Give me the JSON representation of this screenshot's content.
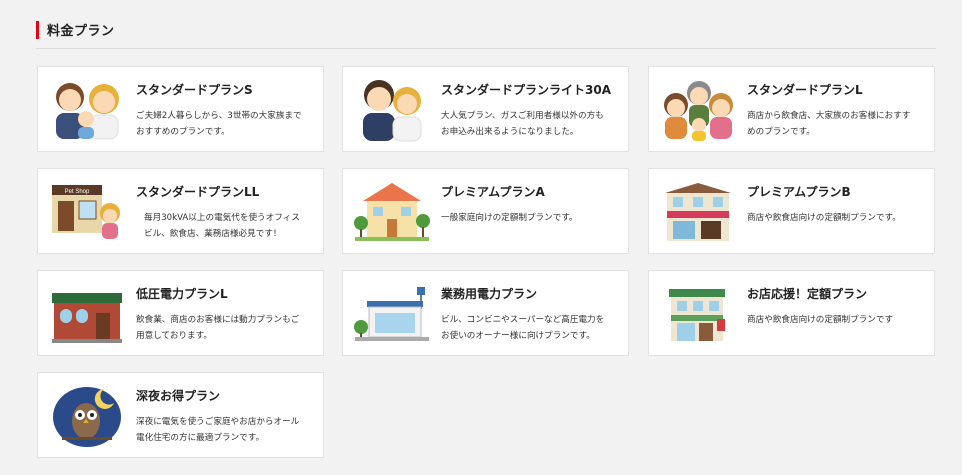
{
  "section": {
    "title": "料金プラン"
  },
  "plans": [
    {
      "name": "スタンダードプランS",
      "desc": [
        "ご夫婦2人暮らしから、3世帯の大家族まで",
        "おすすめのプランです。"
      ]
    },
    {
      "name": "スタンダードプランライト30A",
      "desc": [
        "大人気プラン、ガスご利用者様以外の方も",
        "お申込み出来るようになりました。"
      ]
    },
    {
      "name": "スタンダードプランL",
      "desc": [
        "商店から飲食店、大家族のお客様におすす",
        "めのプランです。"
      ]
    },
    {
      "name": "スタンダードプランLL",
      "desc": [
        "毎月30kVA以上の電気代を使うオフィス",
        "ビル、飲食店、業務店様必見です！"
      ]
    },
    {
      "name": "プレミアムプランA",
      "desc": [
        "一般家庭向けの定額制プランです。"
      ]
    },
    {
      "name": "プレミアムプランB",
      "desc": [
        "商店や飲食店向けの定額制プランです。"
      ]
    },
    {
      "name": "低圧電力プランL",
      "desc": [
        "飲食業、商店のお客様には動力プランもご",
        "用意しております。"
      ]
    },
    {
      "name": "業務用電力プラン",
      "desc": [
        "ビル、コンビニやスーパーなど高圧電力を",
        "お使いのオーナー様に向けプランです。"
      ]
    },
    {
      "name": "お店応援！定額プラン",
      "desc": [
        "商店や飲食店向けの定額制プランです"
      ]
    },
    {
      "name": "深夜お得プラン",
      "desc": [
        "深夜に電気を使うご家庭やお店からオール",
        "電化住宅の方に最適プランです。"
      ]
    }
  ],
  "illustrations": {
    "pet_shop_sign": "Pet Shop"
  },
  "colors": {
    "accent": "#e60012"
  }
}
